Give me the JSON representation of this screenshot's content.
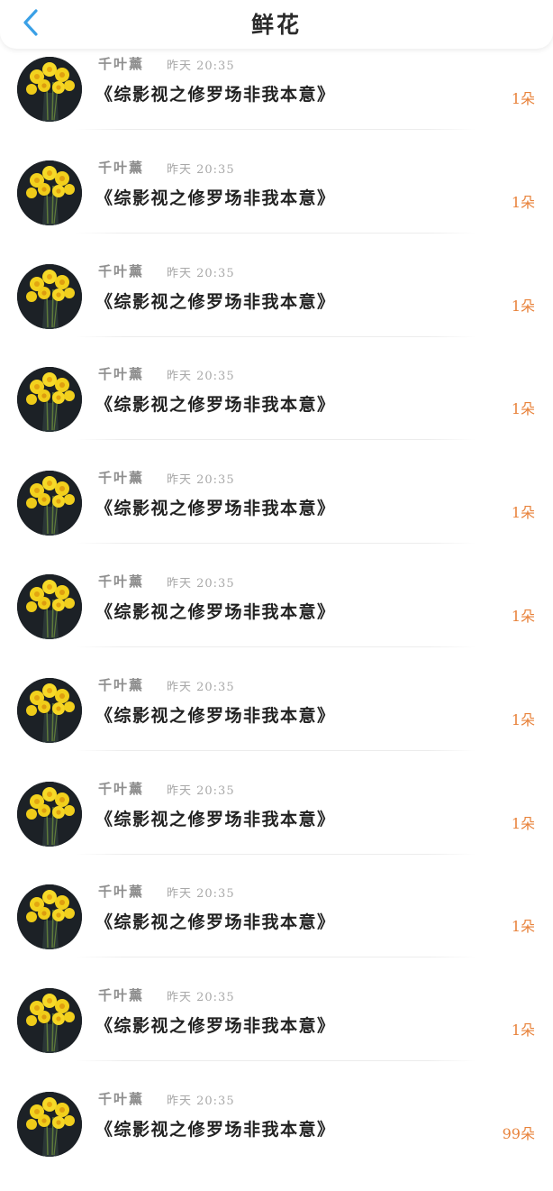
{
  "header": {
    "title": "鲜花",
    "back_icon": "chevron-left-icon"
  },
  "colors": {
    "accent": "#e8823a",
    "back": "#3aa0e6"
  },
  "items": [
    {
      "name": "千叶薰",
      "time": "昨天 20:35",
      "book": "《综影视之修罗场非我本意》",
      "count": "1朵"
    },
    {
      "name": "千叶薰",
      "time": "昨天 20:35",
      "book": "《综影视之修罗场非我本意》",
      "count": "1朵"
    },
    {
      "name": "千叶薰",
      "time": "昨天 20:35",
      "book": "《综影视之修罗场非我本意》",
      "count": "1朵"
    },
    {
      "name": "千叶薰",
      "time": "昨天 20:35",
      "book": "《综影视之修罗场非我本意》",
      "count": "1朵"
    },
    {
      "name": "千叶薰",
      "time": "昨天 20:35",
      "book": "《综影视之修罗场非我本意》",
      "count": "1朵"
    },
    {
      "name": "千叶薰",
      "time": "昨天 20:35",
      "book": "《综影视之修罗场非我本意》",
      "count": "1朵"
    },
    {
      "name": "千叶薰",
      "time": "昨天 20:35",
      "book": "《综影视之修罗场非我本意》",
      "count": "1朵"
    },
    {
      "name": "千叶薰",
      "time": "昨天 20:35",
      "book": "《综影视之修罗场非我本意》",
      "count": "1朵"
    },
    {
      "name": "千叶薰",
      "time": "昨天 20:35",
      "book": "《综影视之修罗场非我本意》",
      "count": "1朵"
    },
    {
      "name": "千叶薰",
      "time": "昨天 20:35",
      "book": "《综影视之修罗场非我本意》",
      "count": "1朵"
    },
    {
      "name": "千叶薰",
      "time": "昨天 20:35",
      "book": "《综影视之修罗场非我本意》",
      "count": "99朵"
    }
  ]
}
